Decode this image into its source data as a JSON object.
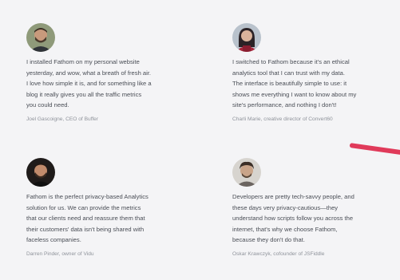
{
  "accent_color": "#e03a5a",
  "testimonials": [
    {
      "quote": "I installed Fathom on my personal website\nyesterday, and wow, what a breath of fresh air.\nI love how simple it is, and for something like a\nblog it really gives you all the traffic metrics\nyou could need.",
      "author": "Joel Gascoigne, CEO of Buffer"
    },
    {
      "quote": "I switched to Fathom because it's an ethical\nanalytics tool that I can trust with my data.\nThe interface is beautifully simple to use: it\nshows me everything I want to know about my\nsite's performance, and nothing I don't!",
      "author": "Charli Marie, creative director of Convert60"
    },
    {
      "quote": "Fathom is the perfect privacy-based Analytics\nsolution for us. We can provide the metrics\nthat our clients need and reassure them that\ntheir customers' data isn't being shared with\nfaceless companies.",
      "author": "Darren Pinder, owner of Vidu"
    },
    {
      "quote": "Developers are pretty tech-savvy people, and\nthese days very privacy-cautious—they\nunderstand how scripts follow you across the\ninternet, that's why we choose Fathom,\nbecause they don't do that.",
      "author": "Oskar Krawczyk, cofounder of JSFiddle"
    }
  ]
}
